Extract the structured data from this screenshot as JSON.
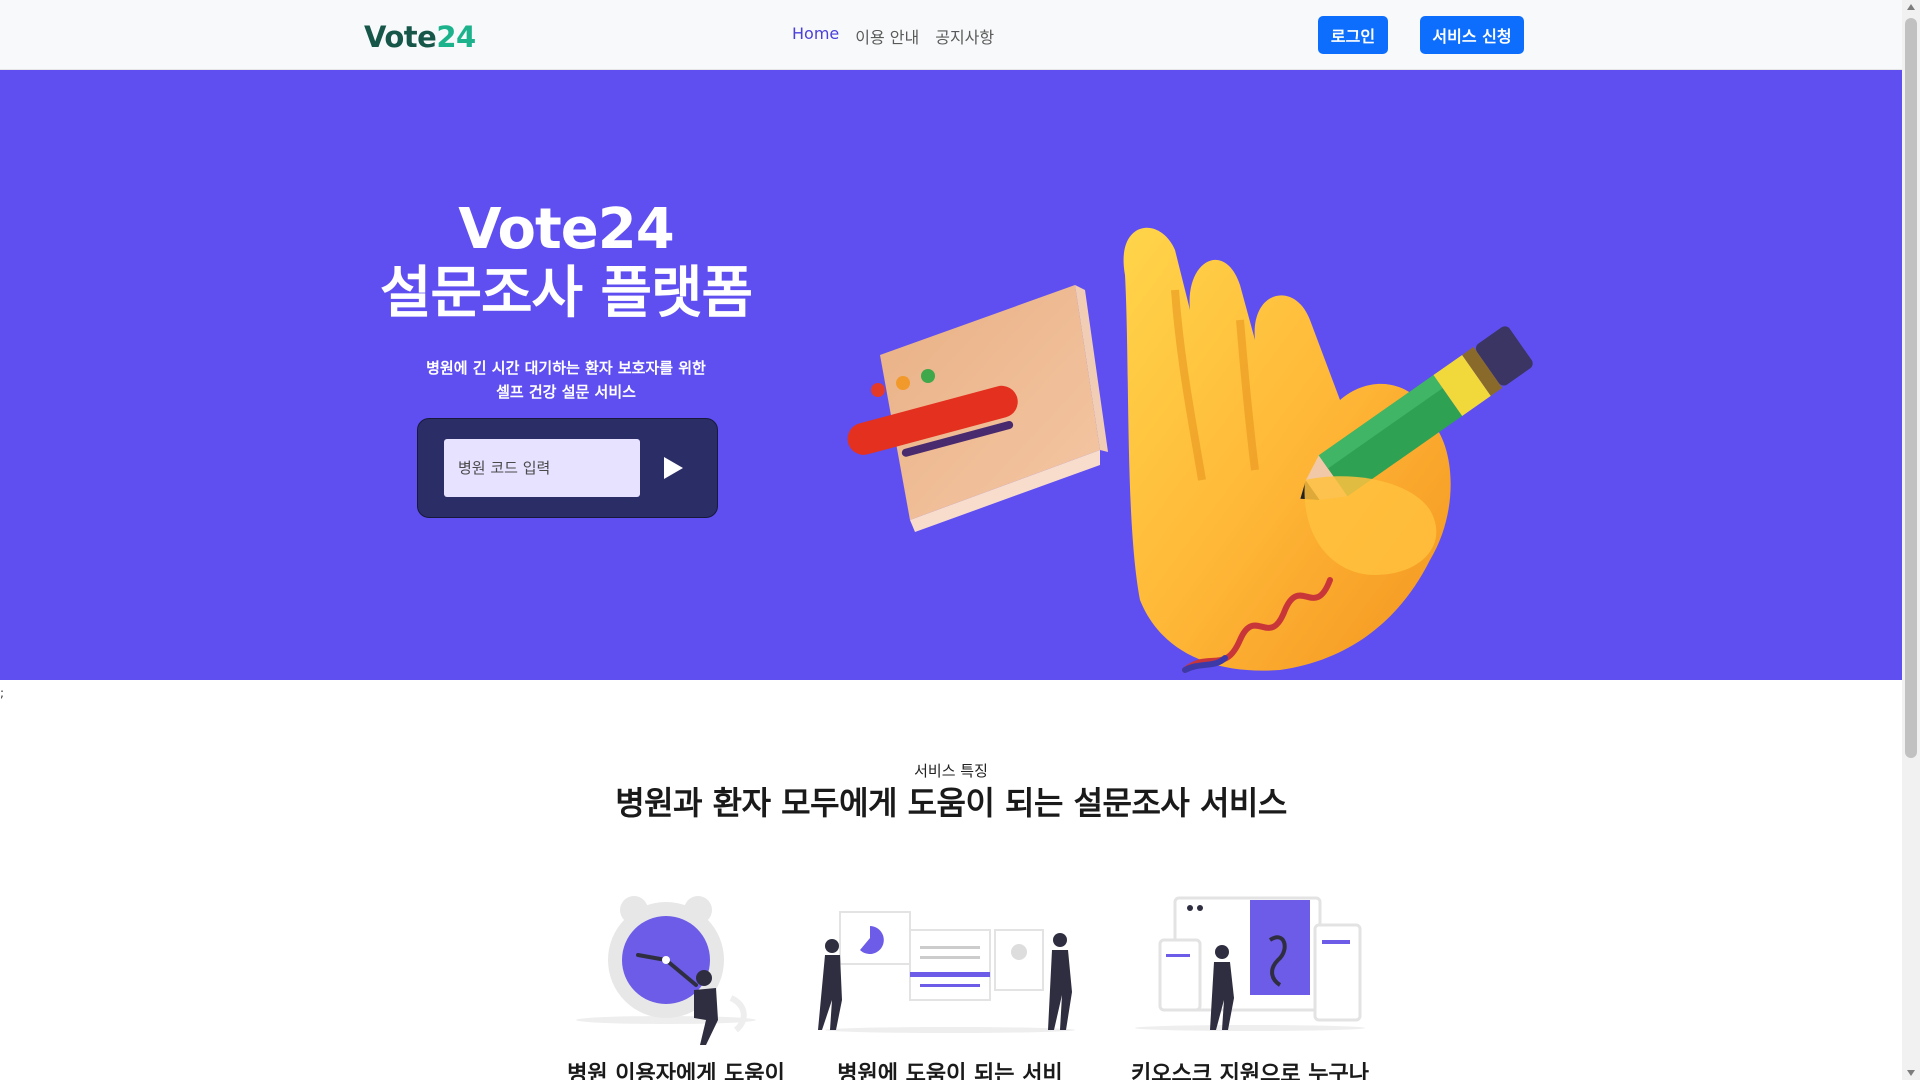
{
  "navbar": {
    "logo_text": "Vote",
    "logo_num": "24",
    "links": [
      "Home",
      "이용 안내",
      "공지사항"
    ],
    "login_label": "로그인",
    "apply_label": "서비스 신청"
  },
  "hero": {
    "title_line1": "Vote24",
    "title_line2": "설문조사 플랫폼",
    "subtitle_line1": "병원에 긴 시간 대기하는 환자 보호자를 위한",
    "subtitle_line2": "셀프 건강 설문 서비스",
    "code_placeholder": "병원 코드 입력"
  },
  "stray_char": ";",
  "features": {
    "eyebrow": "서비스 특징",
    "title": "병원과 환자 모두에게 도움이 되는 설문조사 서비스",
    "cards": [
      {
        "title": "병원 이용자에게 도움이",
        "icon": "clock-illustration"
      },
      {
        "title": "병원에 도움이 되는 서비",
        "icon": "presentation-illustration"
      },
      {
        "title": "키오스크 지원으로 누구나",
        "icon": "kiosk-illustration"
      }
    ]
  },
  "colors": {
    "hero_bg": "#5f4ff0",
    "primary_button": "#0d6efd",
    "code_box": "#2b2d66",
    "accent": "#6c5ce7"
  }
}
